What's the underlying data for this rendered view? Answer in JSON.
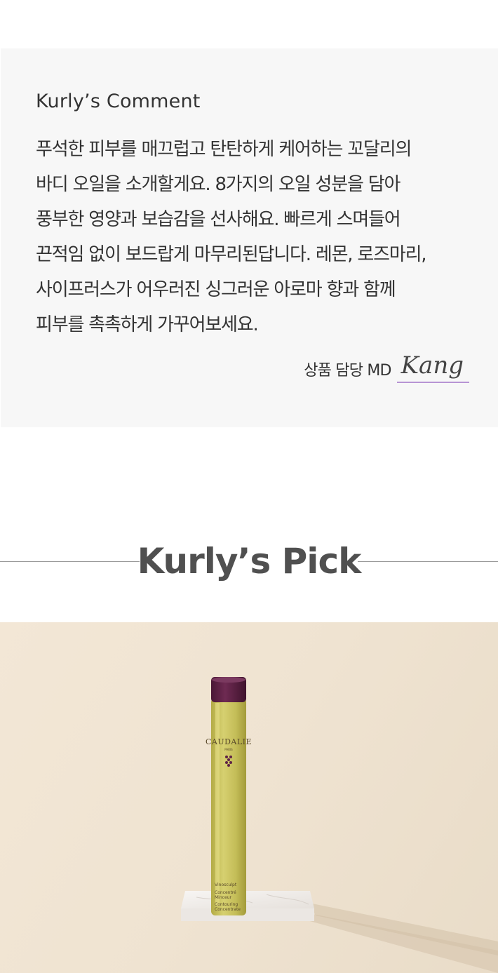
{
  "comment": {
    "title": "Kurly’s Comment",
    "lines": [
      "푸석한 피부를 매끄럽고 탄탄하게 케어하는 꼬달리의",
      "바디 오일을 소개할게요. 8가지의 오일 성분을 담아",
      "풍부한 영양과 보습감을 선사해요. 빠르게 스며들어",
      "끈적임 없이 보드랍게 마무리된답니다. 레몬, 로즈마리,",
      "사이프러스가 어우러진 싱그러운 아로마 향과 함께",
      "피부를 촉촉하게 가꾸어보세요."
    ],
    "signature_label": "상품 담당 MD",
    "signature_name": "Kang",
    "signature_underline_color": "#b794d4"
  },
  "pick": {
    "title": "Kurly’s Pick"
  },
  "product": {
    "brand": "CAUDALIE",
    "brand_sub": "PARIS",
    "label_lines": [
      "Vinosculpt",
      "Concentré",
      "Minceur",
      "Contouring",
      "Concentrate"
    ],
    "cap_color": "#5e2346",
    "oil_color": "#c9c260",
    "background_color": "#efe3d1"
  }
}
